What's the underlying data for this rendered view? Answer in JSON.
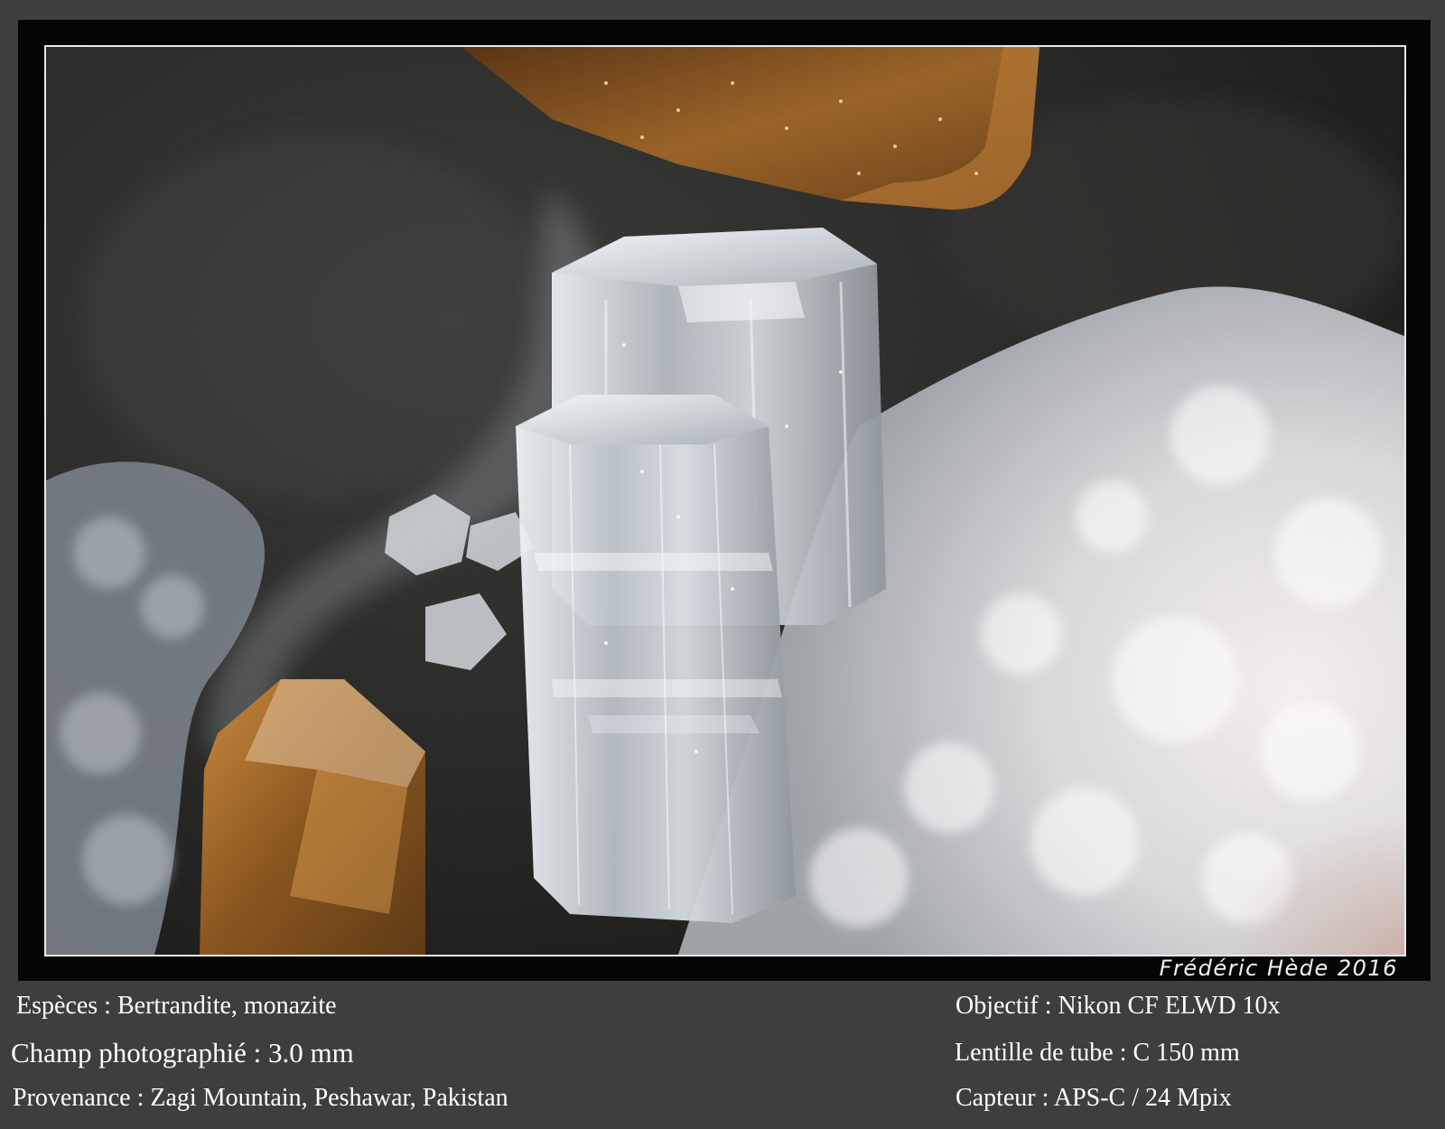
{
  "signature": "Frédéric Hède 2016",
  "captions": {
    "species": "Espèces : Bertrandite, monazite",
    "field": "Champ photographié : 3.0 mm",
    "provenance": "Provenance : Zagi Mountain, Peshawar, Pakistan",
    "objective": "Objectif : Nikon CF ELWD 10x",
    "tube_lens": "Lentille de tube : C 150 mm",
    "sensor": "Capteur : APS-C / 24 Mpix"
  },
  "colors": {
    "page_background": "#3e3e3e",
    "frame": "#050505",
    "photo_border": "#e8e8e8",
    "text": "#ffffff",
    "crystal_monazite": "#8a5a22",
    "crystal_bertrandite": "#d8dde2",
    "matrix": "#e6e2e0"
  }
}
